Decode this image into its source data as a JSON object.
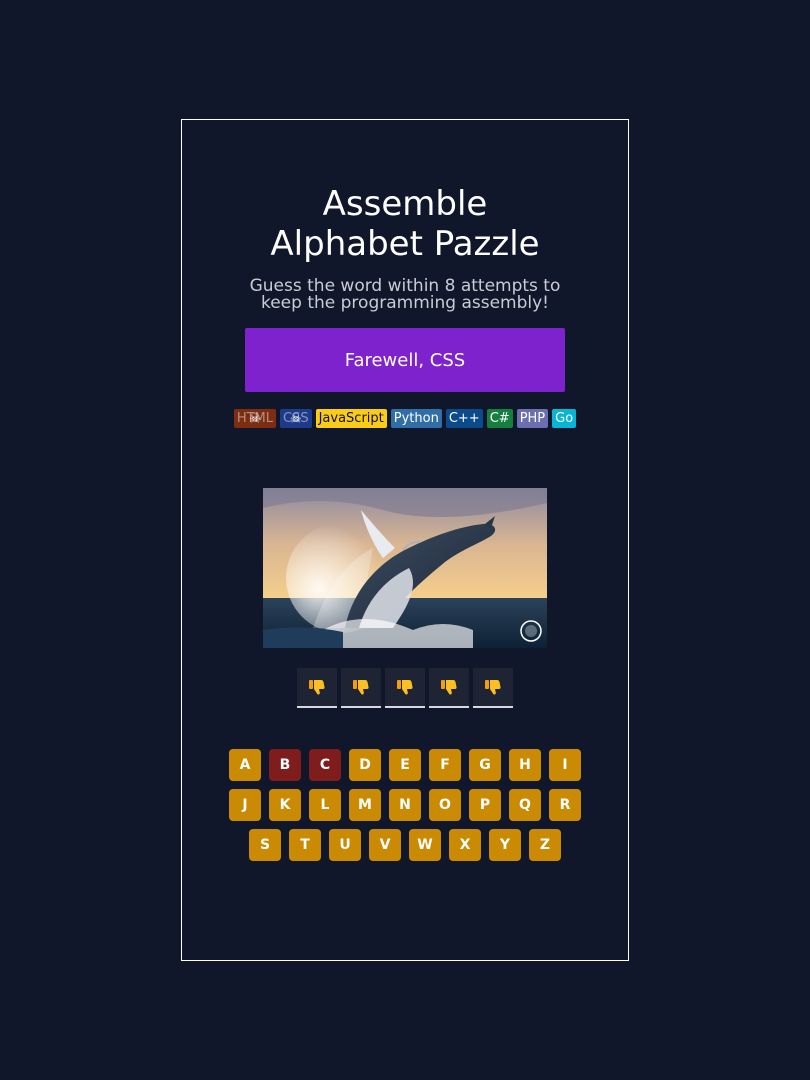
{
  "header": {
    "title_line1": "Assemble",
    "title_line2": "Alphabet Pazzle",
    "subtitle_line1": "Guess the word within 8 attempts to",
    "subtitle_line2": "keep the programming assembly!"
  },
  "status": {
    "message": "Farewell, CSS",
    "color": "#7e22ce"
  },
  "languages": [
    {
      "name": "HTML",
      "bg": "#7c2d12",
      "fg": "#ffffff",
      "lost": true
    },
    {
      "name": "CSS",
      "bg": "#1e3a8a",
      "fg": "#ffffff",
      "lost": true
    },
    {
      "name": "JavaScript",
      "bg": "#facc15",
      "fg": "#111111",
      "lost": false
    },
    {
      "name": "Python",
      "bg": "#2f6fa5",
      "fg": "#ffffff",
      "lost": false
    },
    {
      "name": "C++",
      "bg": "#0b4a8b",
      "fg": "#ffffff",
      "lost": false
    },
    {
      "name": "C#",
      "bg": "#15803d",
      "fg": "#ffffff",
      "lost": false
    },
    {
      "name": "PHP",
      "bg": "#6b6fb0",
      "fg": "#ffffff",
      "lost": false
    },
    {
      "name": "Go",
      "bg": "#06b6d4",
      "fg": "#ffffff",
      "lost": false
    }
  ],
  "lost_marker_icon": "skull-icon",
  "hint_image": {
    "subject": "humpback-whale-breaching-at-sunset"
  },
  "word_slots": [
    {
      "icon": "thumbs-down-icon"
    },
    {
      "icon": "thumbs-down-icon"
    },
    {
      "icon": "thumbs-down-icon"
    },
    {
      "icon": "thumbs-down-icon"
    },
    {
      "icon": "thumbs-down-icon"
    }
  ],
  "keyboard": {
    "rows": [
      [
        "A",
        "B",
        "C",
        "D",
        "E",
        "F",
        "G",
        "H",
        "I"
      ],
      [
        "J",
        "K",
        "L",
        "M",
        "N",
        "O",
        "P",
        "Q",
        "R"
      ],
      [
        "S",
        "T",
        "U",
        "V",
        "W",
        "X",
        "Y",
        "Z"
      ]
    ],
    "used": [
      "B",
      "C"
    ],
    "key_color": "#ca8a04",
    "used_color": "#7f1d1d"
  }
}
